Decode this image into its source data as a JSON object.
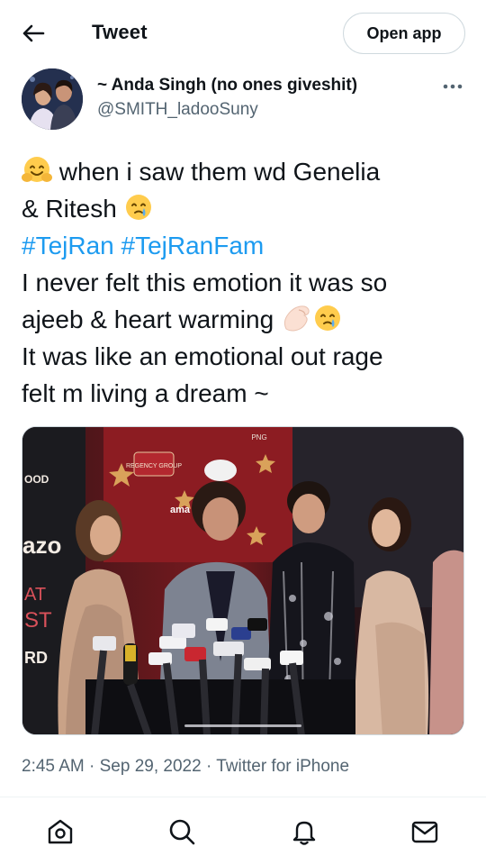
{
  "header": {
    "title": "Tweet",
    "back_icon": "arrow-left-icon",
    "open_app_label": "Open app"
  },
  "author": {
    "display_name": "~ Anda Singh (no ones giveshit)",
    "handle": "@SMITH_ladooSuny",
    "more_icon": "more-horizontal-icon"
  },
  "tweet": {
    "line1_text": " when i saw them wd Genelia",
    "line2_text": "& Ritesh ",
    "hashtag1": "#TejRan",
    "hashtag2": "#TejRanFam",
    "line4_text": "I never felt this emotion it was so",
    "line5_text": "ajeeb & heart warming ",
    "line6_text": "It was like an emotional out rage",
    "line7_text": "felt m living a dream ~",
    "emojis": [
      "hugging-face-emoji",
      "crying-face-emoji",
      "pinched-hand-emoji",
      "crying-face-emoji"
    ]
  },
  "media": {
    "sign_text_1": "PNG",
    "sign_text_2": "ama",
    "sign_text_3": "REGENCY GROUP",
    "side_text_1": "OOD",
    "side_text_2": "azo",
    "side_text_3": "AT",
    "side_text_4": "ST",
    "side_text_5": "RD"
  },
  "meta": {
    "time": "2:45 AM",
    "separator": "·",
    "date": "Sep 29, 2022",
    "source": "Twitter for iPhone"
  },
  "bottom_nav": {
    "icons": [
      "home-icon",
      "search-icon",
      "notifications-icon",
      "messages-icon"
    ]
  },
  "colors": {
    "accent": "#1d9bf0",
    "text": "#0f1419",
    "secondary": "#536471",
    "border": "#cfd9de"
  }
}
